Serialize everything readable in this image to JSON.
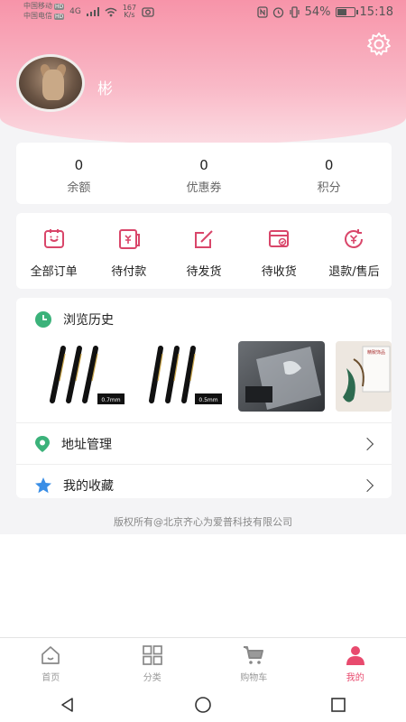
{
  "statusbar": {
    "carrier1": "中国移动",
    "carrier2": "中国电信",
    "hd": "HD",
    "signal": "4G",
    "speed_value": "167",
    "speed_unit": "K/s",
    "battery": "54%",
    "time": "15:18"
  },
  "profile": {
    "username": "彬"
  },
  "stats": [
    {
      "value": "0",
      "label": "余额"
    },
    {
      "value": "0",
      "label": "优惠券"
    },
    {
      "value": "0",
      "label": "积分"
    }
  ],
  "orders": [
    {
      "label": "全部订单",
      "icon": "all-orders-icon"
    },
    {
      "label": "待付款",
      "icon": "pending-payment-icon"
    },
    {
      "label": "待发货",
      "icon": "pending-shipment-icon"
    },
    {
      "label": "待收货",
      "icon": "pending-receipt-icon"
    },
    {
      "label": "退款/售后",
      "icon": "refund-icon"
    }
  ],
  "history": {
    "title": "浏览历史",
    "items": [
      {
        "caption": "0.7mm"
      },
      {
        "caption": "0.5mm"
      },
      {
        "caption": ""
      },
      {
        "caption": "精致饰品"
      }
    ]
  },
  "menu": {
    "address": "地址管理",
    "favorites": "我的收藏"
  },
  "copyright": "版权所有@北京齐心为爱普科技有限公司",
  "tabs": [
    {
      "label": "首页",
      "icon": "home-icon"
    },
    {
      "label": "分类",
      "icon": "category-icon"
    },
    {
      "label": "购物车",
      "icon": "cart-icon"
    },
    {
      "label": "我的",
      "icon": "profile-icon"
    }
  ],
  "colors": {
    "accent": "#e84a6e",
    "header_pink": "#f794a9",
    "icon_red": "#d9466a"
  }
}
